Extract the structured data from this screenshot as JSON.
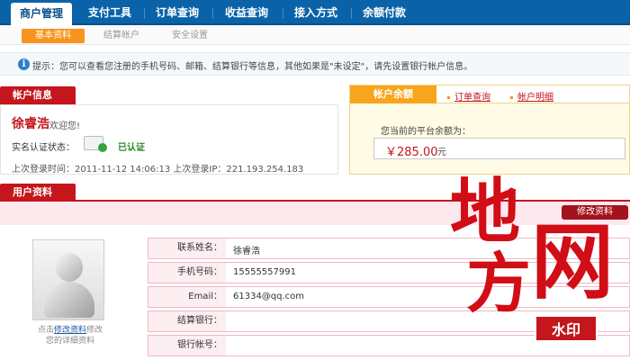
{
  "topnav": {
    "tabs": [
      {
        "label": "商户管理",
        "active": true
      },
      {
        "label": "支付工具",
        "active": false
      },
      {
        "label": "订单查询",
        "active": false
      },
      {
        "label": "收益查询",
        "active": false
      },
      {
        "label": "接入方式",
        "active": false
      },
      {
        "label": "余额付款",
        "active": false
      }
    ]
  },
  "subnav": {
    "items": [
      {
        "label": "基本资料",
        "active": true
      },
      {
        "label": "结算帐户",
        "active": false
      },
      {
        "label": "安全设置",
        "active": false
      }
    ]
  },
  "tip": {
    "icon": "info-icon",
    "text": "提示：您可以查看您注册的手机号码、邮箱、结算银行等信息，其他如果是\"未设定\"，请先设置银行帐户信息。"
  },
  "account": {
    "header": "帐户信息",
    "name": "徐睿浩",
    "welcome": "欢迎您!",
    "verify_label": "实名认证状态：",
    "verify_value": "已认证",
    "last_login_label": "上次登录时间：",
    "last_login_time": "2011-11-12 14:06:13",
    "last_ip_label": "上次登录IP：",
    "last_ip": "221.193.254.183"
  },
  "balance": {
    "tab_active": "帐户余额",
    "link_orders": "订单查询",
    "link_details": "帐户明细",
    "label": "您当前的平台余额为：",
    "amount": "￥285.00",
    "unit": "元"
  },
  "profile": {
    "header": "用户资料",
    "edit_button": "修改资料",
    "avatar_caption_pre": "点击",
    "avatar_caption_link": "修改资料",
    "avatar_caption_post": "修改",
    "avatar_caption_line2": "您的详细资料",
    "fields": [
      {
        "label": "联系姓名：",
        "value": "徐睿浩"
      },
      {
        "label": "手机号码：",
        "value": "15555557991"
      },
      {
        "label": "Email：",
        "value": "61334@qq.com"
      },
      {
        "label": "结算银行：",
        "value": ""
      },
      {
        "label": "银行帐号：",
        "value": ""
      }
    ]
  },
  "watermark": {
    "char1": "地",
    "char2": "网",
    "char3": "方",
    "badge": "水印",
    "color": "#d10d16"
  }
}
